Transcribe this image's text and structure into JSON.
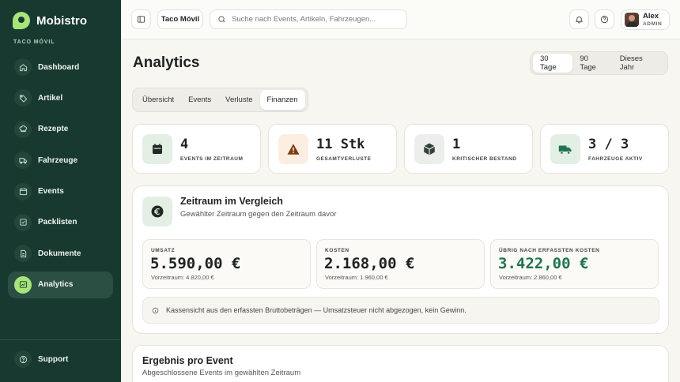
{
  "app": {
    "name": "Mobistro",
    "org_label": "TACO MÓVIL"
  },
  "sidebar": {
    "items": [
      {
        "label": "Dashboard",
        "icon": "home-icon"
      },
      {
        "label": "Artikel",
        "icon": "tag-icon"
      },
      {
        "label": "Rezepte",
        "icon": "chef-icon"
      },
      {
        "label": "Fahrzeuge",
        "icon": "truck-icon"
      },
      {
        "label": "Events",
        "icon": "calendar-icon"
      },
      {
        "label": "Packlisten",
        "icon": "checklist-icon"
      },
      {
        "label": "Dokumente",
        "icon": "document-icon"
      },
      {
        "label": "Analytics",
        "icon": "chart-icon",
        "active": true
      }
    ],
    "support_label": "Support"
  },
  "topbar": {
    "org_button": "Taco Móvil",
    "search_placeholder": "Suche nach Events, Artikeln, Fahrzeugen...",
    "user_name": "Alex",
    "user_role": "ADMIN"
  },
  "page": {
    "title": "Analytics"
  },
  "range": {
    "options": [
      "30 Tage",
      "90 Tage",
      "Dieses Jahr"
    ],
    "selected": "30 Tage"
  },
  "tabs": {
    "items": [
      "Übersicht",
      "Events",
      "Verluste",
      "Finanzen"
    ],
    "selected": "Finanzen"
  },
  "kpis": [
    {
      "value": "4",
      "label": "EVENTS IM ZEITRAUM",
      "icon": "calendar-icon",
      "bg": "#e3efe5",
      "color": "#1e2a24"
    },
    {
      "value": "11 Stk",
      "label": "GESAMTVERLUSTE",
      "icon": "warning-icon",
      "bg": "#fbeee1",
      "color": "#7a3d12"
    },
    {
      "value": "1",
      "label": "KRITISCHER BESTAND",
      "icon": "box-icon",
      "bg": "#eceeec",
      "color": "#33403a"
    },
    {
      "value": "3 / 3",
      "label": "FAHRZEUGE AKTIV",
      "icon": "truck-icon",
      "bg": "#e3efe5",
      "color": "#21744c"
    }
  ],
  "comparison": {
    "title": "Zeitraum im Vergleich",
    "subtitle": "Gewählter Zeitraum gegen den Zeitraum davor",
    "metrics": [
      {
        "label": "UMSATZ",
        "value": "5.590,00 €",
        "prev": "Vorzeitraum: 4.820,00 €"
      },
      {
        "label": "KOSTEN",
        "value": "2.168,00 €",
        "prev": "Vorzeitraum: 1.960,00 €"
      },
      {
        "label": "ÜBRIG NACH ERFASSTEN KOSTEN",
        "value": "3.422,00 €",
        "prev": "Vorzeitraum: 2.860,00 €"
      }
    ],
    "note": "Kassensicht aus den erfassten Bruttobeträgen — Umsatzsteuer nicht abgezogen, kein Gewinn."
  },
  "results": {
    "title": "Ergebnis pro Event",
    "subtitle": "Abgeschlossene Events im gewählten Zeitraum"
  },
  "colors": {
    "sidebar": "#17392f",
    "accent": "#a7e57a",
    "positive": "#21744c"
  }
}
